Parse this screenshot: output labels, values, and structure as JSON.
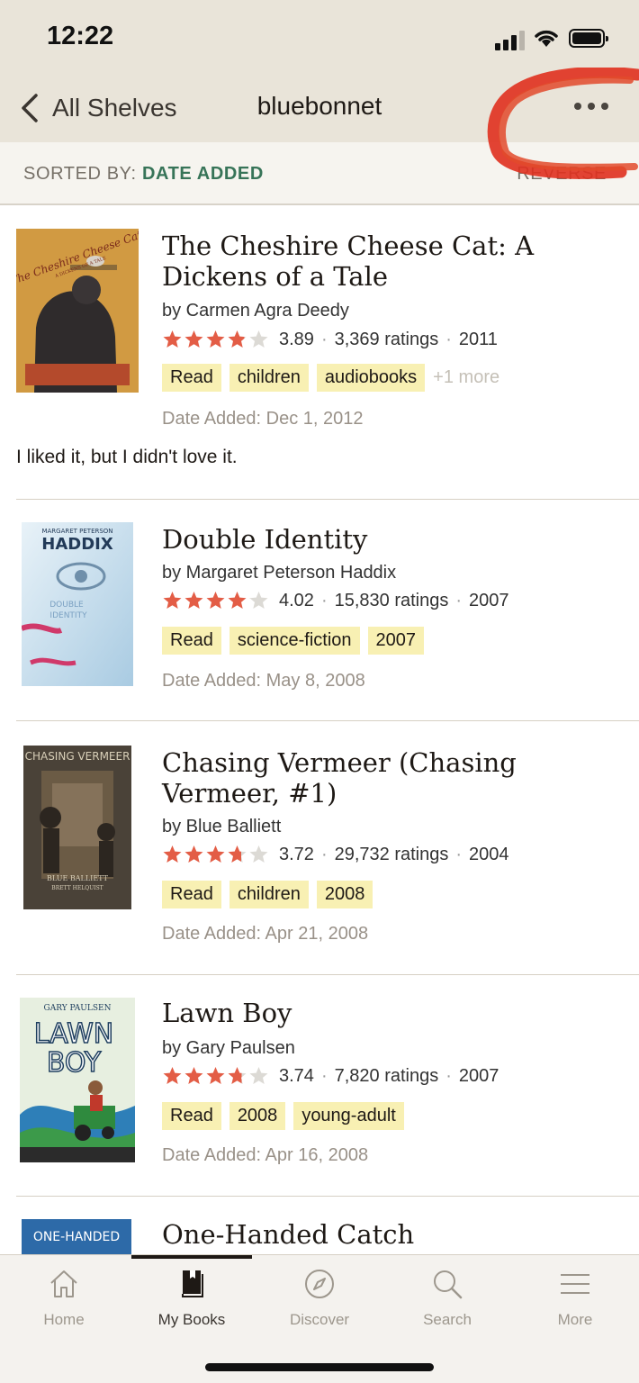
{
  "status": {
    "time": "12:22"
  },
  "nav": {
    "back_label": "All Shelves",
    "title": "bluebonnet"
  },
  "sort": {
    "label": "SORTED BY:",
    "value": "DATE ADDED",
    "reverse": "REVERSE"
  },
  "colors": {
    "accent": "#377458",
    "star": "#e35d46",
    "tag_bg": "#f8f0b3",
    "header_bg": "#e9e4d9",
    "scribble": "#e0301e"
  },
  "books": [
    {
      "title": "The Cheshire Cheese Cat: A Dickens of a Tale",
      "author": "by Carmen Agra Deedy",
      "stars": 3.89,
      "rating": "3.89",
      "ratings": "3,369 ratings",
      "year": "2011",
      "tags": [
        "Read",
        "children",
        "audiobooks"
      ],
      "more_tags": "+1 more",
      "date_added": "Date Added: Dec 1, 2012",
      "review": "I liked it, but I didn't love it.",
      "cover_text": [
        "The Cheshire Cheese Cat",
        "A DICKENS OF A TALE"
      ]
    },
    {
      "title": "Double Identity",
      "author": "by Margaret Peterson Haddix",
      "stars": 4.02,
      "rating": "4.02",
      "ratings": "15,830 ratings",
      "year": "2007",
      "tags": [
        "Read",
        "science-fiction",
        "2007"
      ],
      "date_added": "Date Added: May 8, 2008",
      "cover_text": [
        "MARGARET PETERSON",
        "HADDIX",
        "DOUBLE",
        "IDENTITY"
      ]
    },
    {
      "title": "Chasing Vermeer (Chasing Vermeer, #1)",
      "author": "by Blue Balliett",
      "stars": 3.72,
      "rating": "3.72",
      "ratings": "29,732 ratings",
      "year": "2004",
      "tags": [
        "Read",
        "children",
        "2008"
      ],
      "date_added": "Date Added: Apr 21, 2008",
      "cover_text": [
        "CHASING VERMEER",
        "BLUE BALLIETT",
        "BRETT HELQUIST"
      ]
    },
    {
      "title": "Lawn Boy",
      "author": "by Gary Paulsen",
      "stars": 3.74,
      "rating": "3.74",
      "ratings": "7,820 ratings",
      "year": "2007",
      "tags": [
        "Read",
        "2008",
        "young-adult"
      ],
      "date_added": "Date Added: Apr 16, 2008",
      "cover_text": [
        "GARY PAULSEN",
        "LAWN",
        "BOY"
      ]
    },
    {
      "title": "One-Handed Catch",
      "cover_text": [
        "ONE-HANDED"
      ]
    }
  ],
  "tabs": [
    {
      "label": "Home",
      "icon": "home-icon"
    },
    {
      "label": "My Books",
      "icon": "book-icon"
    },
    {
      "label": "Discover",
      "icon": "compass-icon"
    },
    {
      "label": "Search",
      "icon": "search-icon"
    },
    {
      "label": "More",
      "icon": "menu-icon"
    }
  ]
}
